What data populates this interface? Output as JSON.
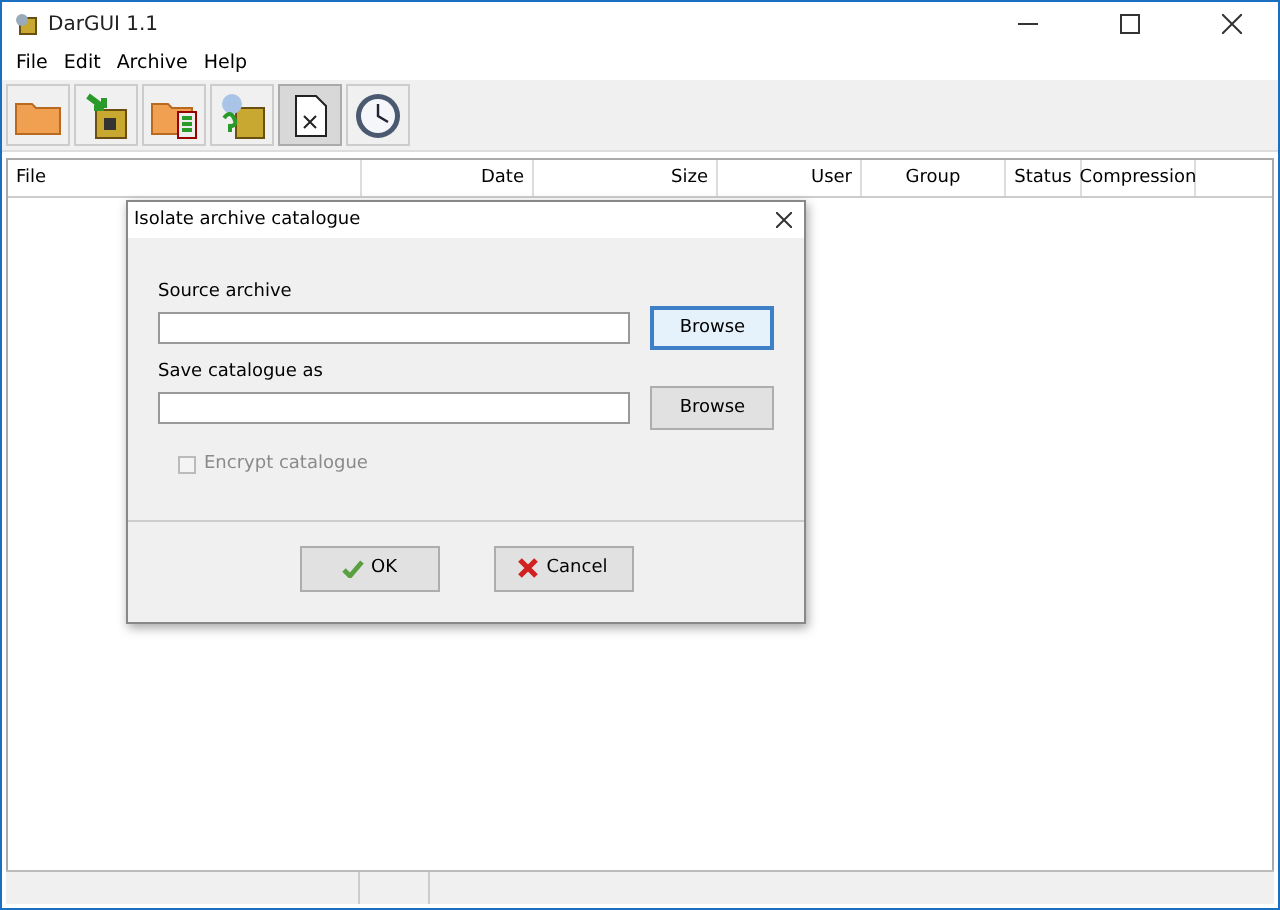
{
  "window": {
    "title": "DarGUI 1.1"
  },
  "menu": [
    "File",
    "Edit",
    "Archive",
    "Help"
  ],
  "toolbar": [
    {
      "kind": "folder",
      "pressed": false
    },
    {
      "kind": "extract",
      "pressed": false
    },
    {
      "kind": "folder-list",
      "pressed": false
    },
    {
      "kind": "query",
      "pressed": false
    },
    {
      "kind": "document",
      "pressed": true
    },
    {
      "kind": "clock",
      "pressed": false
    }
  ],
  "table": {
    "columns": [
      "File",
      "Date",
      "Size",
      "User",
      "Group",
      "Status",
      "Compression"
    ]
  },
  "dialog": {
    "title": "Isolate archive catalogue",
    "fields": [
      {
        "label": "Source archive",
        "button": "Browse",
        "focused": true
      },
      {
        "label": "Save catalogue as",
        "button": "Browse",
        "focused": false
      }
    ],
    "checkbox": {
      "label": "Encrypt catalogue",
      "checked": false,
      "disabled": true
    },
    "buttons": [
      {
        "kind": "ok",
        "label": "OK"
      },
      {
        "kind": "cancel",
        "label": "Cancel"
      }
    ]
  }
}
